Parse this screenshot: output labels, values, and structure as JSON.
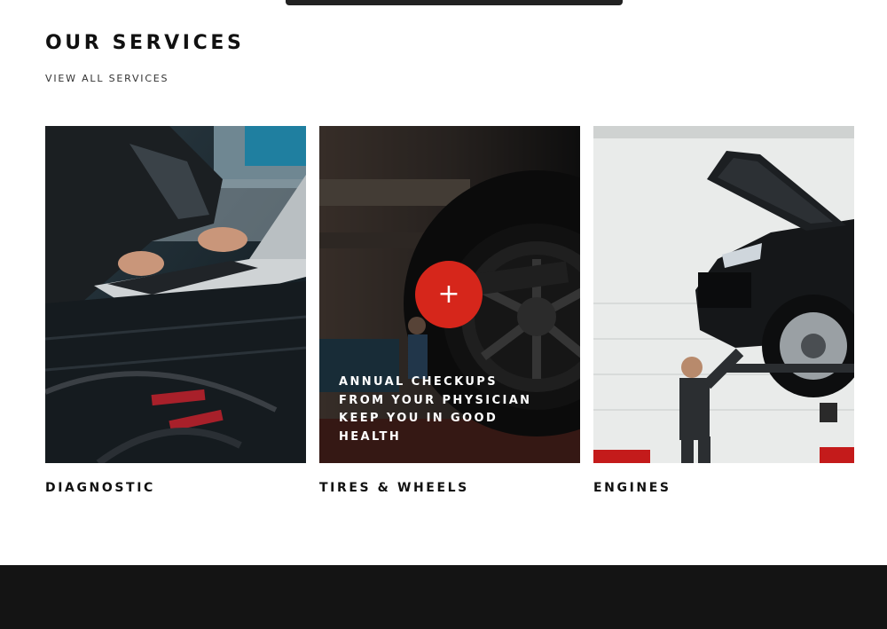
{
  "section": {
    "title": "OUR SERVICES",
    "view_all": "VIEW ALL SERVICES"
  },
  "services": [
    {
      "name": "DIAGNOSTIC"
    },
    {
      "name": "TIRES & WHEELS",
      "description": "ANNUAL CHECKUPS FROM YOUR PHYSICIAN KEEP YOU IN GOOD HEALTH",
      "action_icon": "+"
    },
    {
      "name": "ENGINES"
    }
  ],
  "colors": {
    "accent": "#d6261b",
    "footer_bg": "#141414",
    "text": "#111111"
  }
}
